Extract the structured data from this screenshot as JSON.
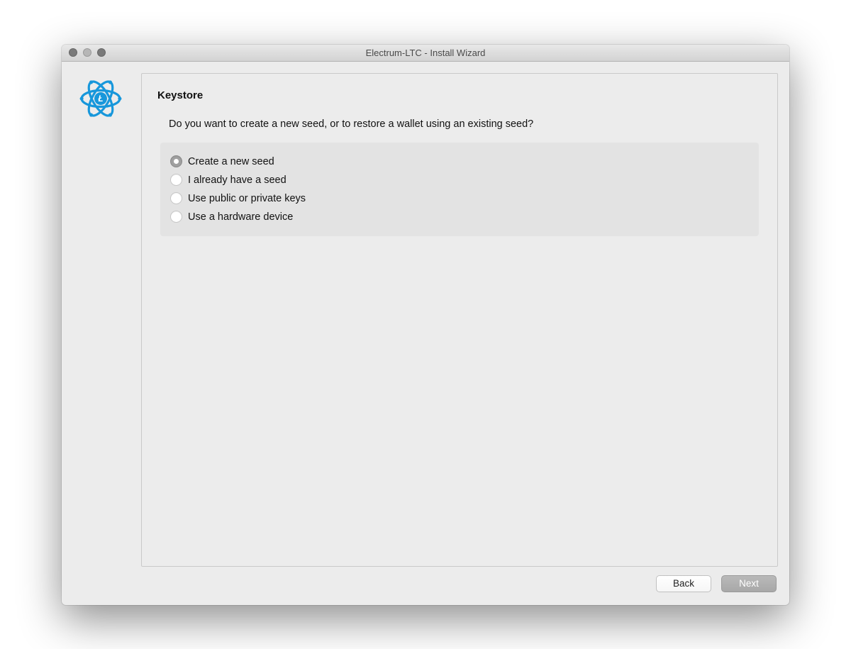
{
  "window": {
    "title": "Electrum-LTC  -  Install Wizard"
  },
  "content": {
    "heading": "Keystore",
    "question": "Do you want to create a new seed, or to restore a wallet using an existing seed?",
    "options": [
      {
        "label": "Create a new seed",
        "selected": true
      },
      {
        "label": "I already have a seed",
        "selected": false
      },
      {
        "label": "Use public or private keys",
        "selected": false
      },
      {
        "label": "Use a hardware device",
        "selected": false
      }
    ]
  },
  "buttons": {
    "back": "Back",
    "next": "Next"
  },
  "icon": {
    "name": "electrum-ltc-logo",
    "accent_color": "#1797db"
  }
}
